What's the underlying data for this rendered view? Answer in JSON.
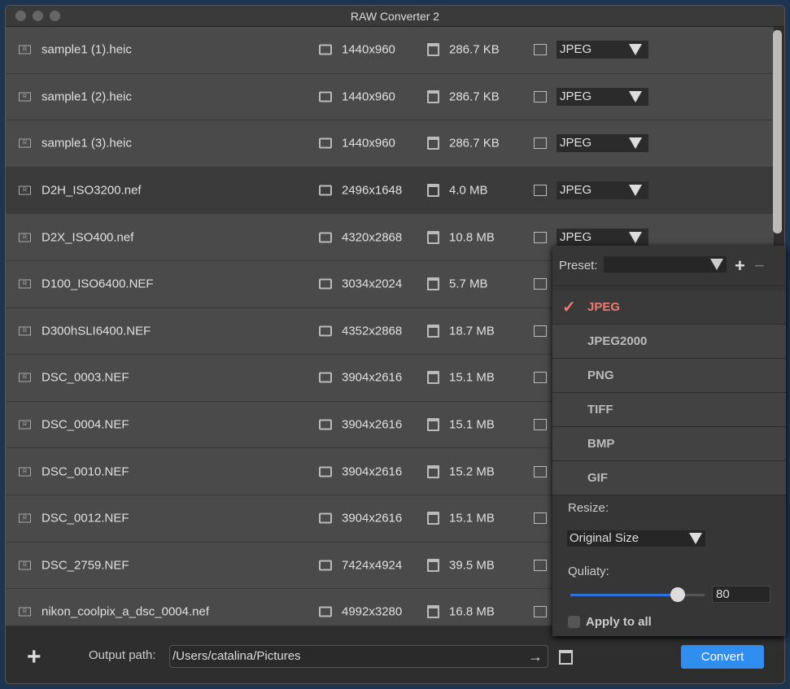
{
  "window": {
    "title": "RAW Converter 2"
  },
  "files": [
    {
      "name": "sample1 (1).heic",
      "dims": "1440x960",
      "size": "286.7 KB",
      "format": "JPEG"
    },
    {
      "name": "sample1 (2).heic",
      "dims": "1440x960",
      "size": "286.7 KB",
      "format": "JPEG"
    },
    {
      "name": "sample1 (3).heic",
      "dims": "1440x960",
      "size": "286.7 KB",
      "format": "JPEG"
    },
    {
      "name": "D2H_ISO3200.nef",
      "dims": "2496x1648",
      "size": "4.0 MB",
      "format": "JPEG",
      "selected": true
    },
    {
      "name": "D2X_ISO400.nef",
      "dims": "4320x2868",
      "size": "10.8 MB",
      "format": "JPEG"
    },
    {
      "name": "D100_ISO6400.NEF",
      "dims": "3034x2024",
      "size": "5.7 MB"
    },
    {
      "name": "D300hSLI6400.NEF",
      "dims": "4352x2868",
      "size": "18.7 MB"
    },
    {
      "name": "DSC_0003.NEF",
      "dims": "3904x2616",
      "size": "15.1 MB"
    },
    {
      "name": "DSC_0004.NEF",
      "dims": "3904x2616",
      "size": "15.1 MB"
    },
    {
      "name": "DSC_0010.NEF",
      "dims": "3904x2616",
      "size": "15.2 MB"
    },
    {
      "name": "DSC_0012.NEF",
      "dims": "3904x2616",
      "size": "15.1 MB"
    },
    {
      "name": "DSC_2759.NEF",
      "dims": "7424x4924",
      "size": "39.5 MB"
    },
    {
      "name": "nikon_coolpix_a_dsc_0004.nef",
      "dims": "4992x3280",
      "size": "16.8 MB"
    }
  ],
  "popup": {
    "preset_label": "Preset:",
    "preset_value": "",
    "add": "+",
    "remove": "−",
    "formats": [
      "JPEG",
      "JPEG2000",
      "PNG",
      "TIFF",
      "BMP",
      "GIF"
    ],
    "selected_format": "JPEG",
    "check": "✓",
    "resize_label": "Resize:",
    "resize_value": "Original Size",
    "quality_label": "Quliaty:",
    "quality_value": "80",
    "quality_percent": 80,
    "apply_all_label": "Apply to all",
    "apply_all_checked": false
  },
  "footer": {
    "add": "+",
    "output_label": "Output path:",
    "output_path": "/Users/catalina/Pictures",
    "arrow": "→",
    "convert": "Convert"
  },
  "colors": {
    "accent": "#2f8ef0",
    "selected_format": "#f07a70"
  }
}
